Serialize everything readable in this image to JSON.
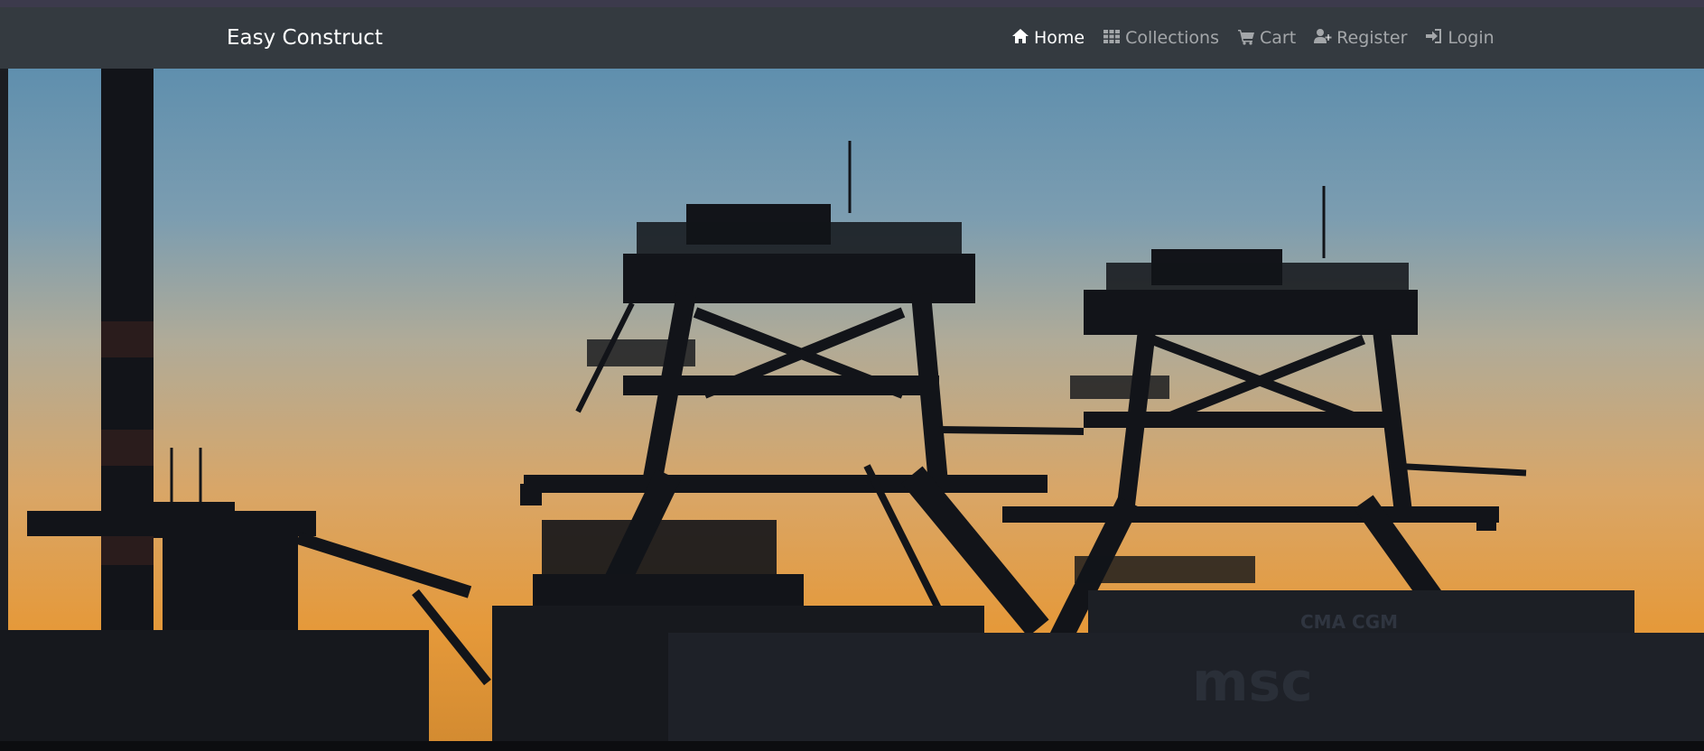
{
  "navbar": {
    "brand": "Easy Construct",
    "items": [
      {
        "label": "Home",
        "icon": "home-icon",
        "active": true
      },
      {
        "label": "Collections",
        "icon": "grid-icon",
        "active": false
      },
      {
        "label": "Cart",
        "icon": "cart-icon",
        "active": false
      },
      {
        "label": "Register",
        "icon": "user-plus-icon",
        "active": false
      },
      {
        "label": "Login",
        "icon": "sign-in-icon",
        "active": false
      }
    ]
  },
  "hero": {
    "image": "port-cranes-sunset-silhouette",
    "container_label": "CMA CGM",
    "container_label_2": "msc"
  },
  "colors": {
    "navbar_bg": "#343a40",
    "sky_top": "#5f8fae",
    "sky_bottom": "#e59a3a",
    "silhouette": "#121419"
  }
}
